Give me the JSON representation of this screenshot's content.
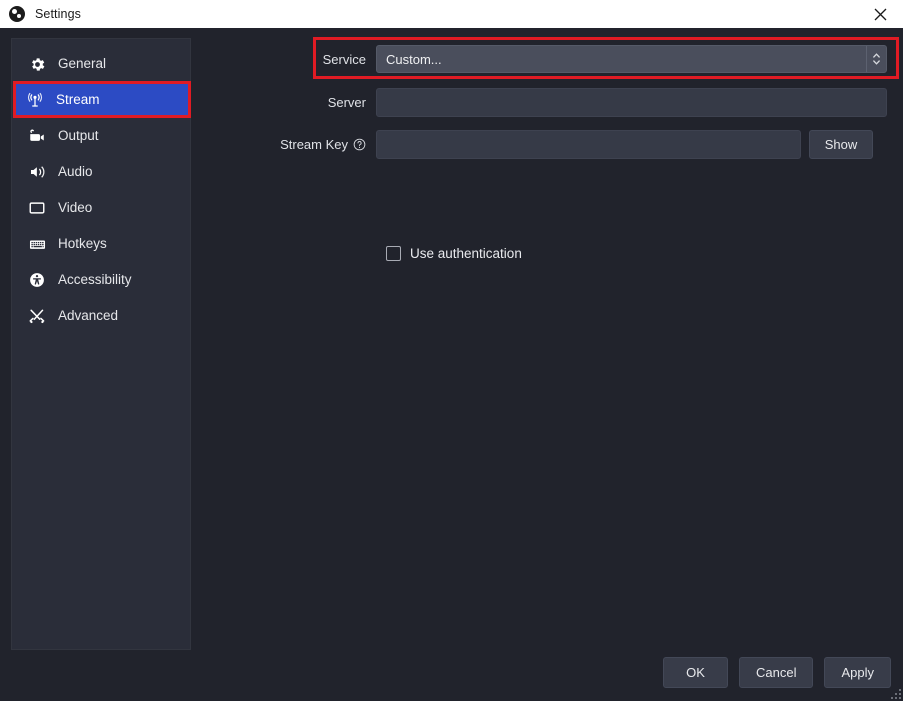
{
  "window": {
    "title": "Settings",
    "app_icon": "obs-logo-icon",
    "close_icon": "close-icon"
  },
  "sidebar": {
    "items": [
      {
        "label": "General",
        "icon": "gear-icon",
        "selected": false
      },
      {
        "label": "Stream",
        "icon": "broadcast-icon",
        "selected": true
      },
      {
        "label": "Output",
        "icon": "output-camera-icon",
        "selected": false
      },
      {
        "label": "Audio",
        "icon": "speaker-icon",
        "selected": false
      },
      {
        "label": "Video",
        "icon": "monitor-icon",
        "selected": false
      },
      {
        "label": "Hotkeys",
        "icon": "keyboard-icon",
        "selected": false
      },
      {
        "label": "Accessibility",
        "icon": "accessibility-icon",
        "selected": false
      },
      {
        "label": "Advanced",
        "icon": "tools-icon",
        "selected": false
      }
    ]
  },
  "stream_settings": {
    "service": {
      "label": "Service",
      "value": "Custom...",
      "dropdown_icon": "updown-chevrons-icon"
    },
    "server": {
      "label": "Server",
      "value": "",
      "placeholder": ""
    },
    "stream_key": {
      "label": "Stream Key",
      "help_icon": "question-help-icon",
      "value": "",
      "placeholder": "",
      "show_button": "Show"
    },
    "use_authentication": {
      "label": "Use authentication",
      "checked": false
    }
  },
  "footer": {
    "ok": "OK",
    "cancel": "Cancel",
    "apply": "Apply"
  },
  "annotations": {
    "highlight_color": "#e01b24",
    "boxes": [
      "stream-sidebar-item",
      "service-dropdown-row"
    ]
  },
  "colors": {
    "selection_blue": "#2c4bc4",
    "panel_bg": "#2a2d39",
    "window_bg": "#21232c",
    "titlebar_bg": "#ffffff"
  }
}
